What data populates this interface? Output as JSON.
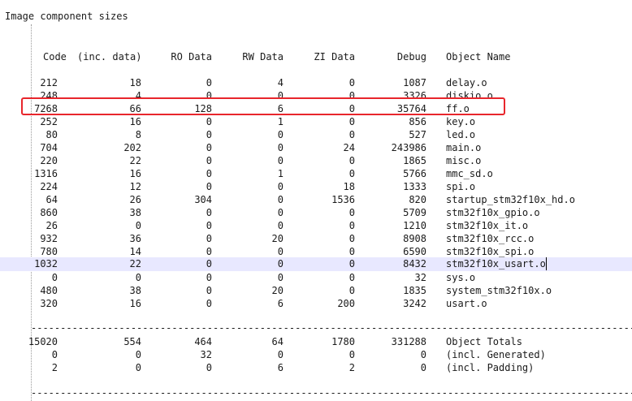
{
  "title": "Image component sizes",
  "headers": {
    "code": "Code",
    "inc_data": "(inc. data)",
    "ro": "RO Data",
    "rw": "RW Data",
    "zi": "ZI Data",
    "debug": "Debug",
    "name": "Object Name"
  },
  "rows": [
    {
      "code": "212",
      "inc": "18",
      "ro": "0",
      "rw": "4",
      "zi": "0",
      "debug": "1087",
      "name": "delay.o"
    },
    {
      "code": "248",
      "inc": "4",
      "ro": "0",
      "rw": "0",
      "zi": "0",
      "debug": "3326",
      "name": "diskio.o"
    },
    {
      "code": "7268",
      "inc": "66",
      "ro": "128",
      "rw": "6",
      "zi": "0",
      "debug": "35764",
      "name": "ff.o"
    },
    {
      "code": "252",
      "inc": "16",
      "ro": "0",
      "rw": "1",
      "zi": "0",
      "debug": "856",
      "name": "key.o"
    },
    {
      "code": "80",
      "inc": "8",
      "ro": "0",
      "rw": "0",
      "zi": "0",
      "debug": "527",
      "name": "led.o"
    },
    {
      "code": "704",
      "inc": "202",
      "ro": "0",
      "rw": "0",
      "zi": "24",
      "debug": "243986",
      "name": "main.o"
    },
    {
      "code": "220",
      "inc": "22",
      "ro": "0",
      "rw": "0",
      "zi": "0",
      "debug": "1865",
      "name": "misc.o"
    },
    {
      "code": "1316",
      "inc": "16",
      "ro": "0",
      "rw": "1",
      "zi": "0",
      "debug": "5766",
      "name": "mmc_sd.o"
    },
    {
      "code": "224",
      "inc": "12",
      "ro": "0",
      "rw": "0",
      "zi": "18",
      "debug": "1333",
      "name": "spi.o"
    },
    {
      "code": "64",
      "inc": "26",
      "ro": "304",
      "rw": "0",
      "zi": "1536",
      "debug": "820",
      "name": "startup_stm32f10x_hd.o"
    },
    {
      "code": "860",
      "inc": "38",
      "ro": "0",
      "rw": "0",
      "zi": "0",
      "debug": "5709",
      "name": "stm32f10x_gpio.o"
    },
    {
      "code": "26",
      "inc": "0",
      "ro": "0",
      "rw": "0",
      "zi": "0",
      "debug": "1210",
      "name": "stm32f10x_it.o"
    },
    {
      "code": "932",
      "inc": "36",
      "ro": "0",
      "rw": "20",
      "zi": "0",
      "debug": "8908",
      "name": "stm32f10x_rcc.o"
    },
    {
      "code": "780",
      "inc": "14",
      "ro": "0",
      "rw": "0",
      "zi": "0",
      "debug": "6590",
      "name": "stm32f10x_spi.o"
    },
    {
      "code": "1032",
      "inc": "22",
      "ro": "0",
      "rw": "0",
      "zi": "0",
      "debug": "8432",
      "name": "stm32f10x_usart.o"
    },
    {
      "code": "0",
      "inc": "0",
      "ro": "0",
      "rw": "0",
      "zi": "0",
      "debug": "32",
      "name": "sys.o"
    },
    {
      "code": "480",
      "inc": "38",
      "ro": "0",
      "rw": "20",
      "zi": "0",
      "debug": "1835",
      "name": "system_stm32f10x.o"
    },
    {
      "code": "320",
      "inc": "16",
      "ro": "0",
      "rw": "6",
      "zi": "200",
      "debug": "3242",
      "name": "usart.o"
    }
  ],
  "separator": "-------------------------------------------------------------------------------------------------------",
  "totals": [
    {
      "code": "15020",
      "inc": "554",
      "ro": "464",
      "rw": "64",
      "zi": "1780",
      "debug": "331288",
      "name": "Object Totals"
    },
    {
      "code": "0",
      "inc": "0",
      "ro": "32",
      "rw": "0",
      "zi": "0",
      "debug": "0",
      "name": "(incl. Generated)"
    },
    {
      "code": "2",
      "inc": "0",
      "ro": "0",
      "rw": "6",
      "zi": "2",
      "debug": "0",
      "name": "(incl. Padding)"
    }
  ],
  "highlight_color": "#e8262c",
  "selected_row_color": "#e8e8ff"
}
